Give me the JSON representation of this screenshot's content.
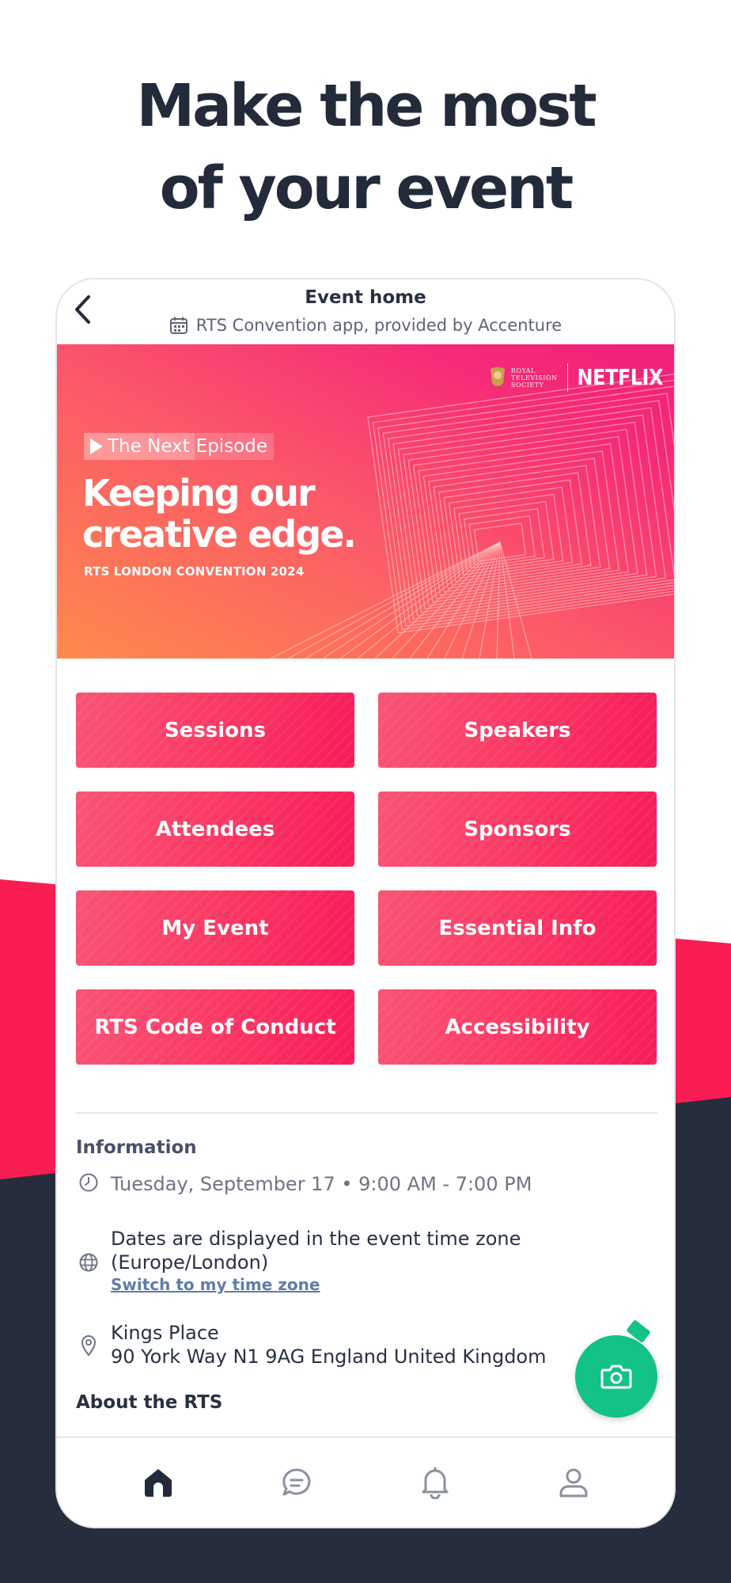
{
  "promo": {
    "headline_line1": "Make the most",
    "headline_line2": "of your event"
  },
  "colors": {
    "accent_red": "#f91d54",
    "dark_navy": "#262e3e",
    "tile_gradient_start": "#f85476",
    "tile_gradient_end": "#f71c58",
    "fab_green": "#13c286"
  },
  "app_bar": {
    "back_icon": "chevron-left-icon",
    "title": "Event home",
    "subtitle_icon": "calendar-icon",
    "subtitle": "RTS Convention app, provided by Accenture"
  },
  "banner": {
    "rts_logo_lines": [
      "ROYAL",
      "TELEVISION",
      "SOCIETY"
    ],
    "partner_logo": "NETFLIX",
    "tag_part1": "The Next",
    "tag_part2": "Episode",
    "headline_line1": "Keeping our",
    "headline_line2": "creative edge.",
    "caption": "RTS LONDON CONVENTION 2024"
  },
  "tiles": [
    {
      "label": "Sessions"
    },
    {
      "label": "Speakers"
    },
    {
      "label": "Attendees"
    },
    {
      "label": "Sponsors"
    },
    {
      "label": "My Event"
    },
    {
      "label": "Essential Info"
    },
    {
      "label": "RTS Code of Conduct"
    },
    {
      "label": "Accessibility"
    }
  ],
  "information": {
    "heading": "Information",
    "date_icon": "clock-icon",
    "date_text": "Tuesday, September 17 • 9:00 AM - 7:00 PM",
    "timezone_icon": "globe-icon",
    "timezone_line1": "Dates are displayed in the event time zone",
    "timezone_line2": "(Europe/London)",
    "timezone_link": "Switch to my time zone",
    "location_icon": "map-pin-icon",
    "location_line1": "Kings Place",
    "location_line2": "90 York Way N1 9AG England United Kingdom"
  },
  "about": {
    "heading": "About the RTS"
  },
  "fab": {
    "icon": "camera-icon"
  },
  "bottom_nav": [
    {
      "icon": "home-icon",
      "active": true
    },
    {
      "icon": "chat-icon",
      "active": false
    },
    {
      "icon": "bell-icon",
      "active": false
    },
    {
      "icon": "profile-icon",
      "active": false
    }
  ]
}
